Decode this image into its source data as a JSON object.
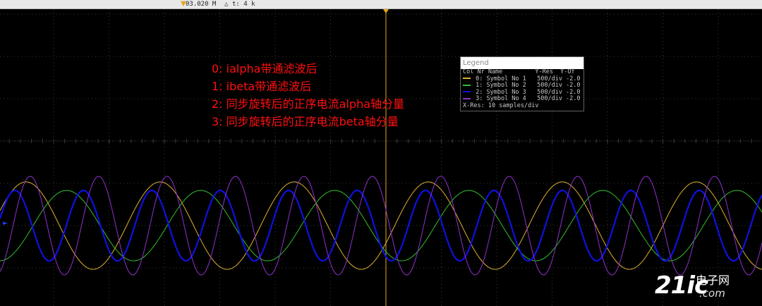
{
  "toolbar": {
    "marker_icon": "trigger-marker-icon",
    "position_text": "03.020 M",
    "delta_icon": "delta-icon",
    "delta_text": "t: 4 k"
  },
  "annotations": [
    "0:  ialpha带通滤波后",
    "1:  ibeta带通滤波后",
    "2:  同步旋转后的正序电流alpha轴分量",
    "3:  同步旋转后的正序电流beta轴分量"
  ],
  "legend": {
    "title": "Legend",
    "header": "Col Nr Name         Y-Res  Y-Of",
    "rows": [
      {
        "text": " 0: Symbol No 1   500/div -2.0",
        "color": "#e0b030"
      },
      {
        "text": " 1: Symbol No 2   500/div -2.0",
        "color": "#30c030"
      },
      {
        "text": " 2: Symbol No 3   500/div -2.0",
        "color": "#1010e0"
      },
      {
        "text": " 3: Symbol No 4   500/div -2.0",
        "color": "#9030d0"
      }
    ],
    "footer": "X-Res: 10 samples/div"
  },
  "watermark": {
    "main": "21ic",
    "cn": "电子网",
    "com": ".com"
  },
  "colors": {
    "background": "#000000",
    "grid": "#3a3a3a",
    "cursor": "#e6a817",
    "trace0": "#e0b030",
    "trace1": "#30c030",
    "trace2": "#1010e0",
    "trace3": "#9030d0"
  }
}
